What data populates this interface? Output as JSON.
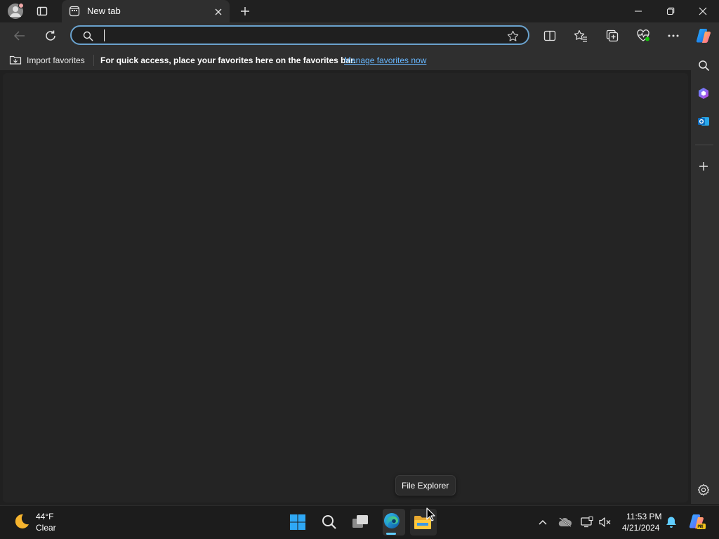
{
  "browser": {
    "tab_title": "New tab",
    "address_value": "",
    "favorites_bar": {
      "import_label": "Import favorites",
      "message": "For quick access, place your favorites here on the favorites bar.",
      "manage_link": "Manage favorites now"
    }
  },
  "tooltip": {
    "text": "File Explorer"
  },
  "taskbar": {
    "weather": {
      "temperature": "44°F",
      "condition": "Clear"
    },
    "clock": {
      "time": "11:53 PM",
      "date": "4/21/2024"
    }
  },
  "colors": {
    "accent": "#60cdff",
    "link": "#67b7ff",
    "address_border": "#6aa2cd"
  },
  "icons": {
    "titlebar": [
      "profile-avatar-icon",
      "tab-actions-icon",
      "new-tab-page-icon",
      "close-tab-icon",
      "new-tab-icon",
      "minimize-icon",
      "restore-icon",
      "close-window-icon"
    ],
    "toolbar": [
      "back-icon",
      "refresh-icon",
      "search-icon",
      "add-favorite-star-icon",
      "split-screen-icon",
      "favorites-icon",
      "collections-icon",
      "browser-essentials-icon",
      "more-menu-icon",
      "copilot-icon"
    ],
    "sidebar": [
      "sidebar-search-icon",
      "copilot-sidebar-icon",
      "outlook-icon",
      "add-sidebar-app-icon",
      "sidebar-settings-icon"
    ],
    "taskbar": [
      "weather-moon-icon",
      "start-windows-icon",
      "taskbar-search-icon",
      "task-view-icon",
      "edge-icon",
      "file-explorer-icon",
      "show-hidden-icons-chevron",
      "onedrive-offline-icon",
      "display-icon",
      "volume-mute-icon",
      "notification-bell-icon",
      "copilot-pre-icon"
    ]
  }
}
